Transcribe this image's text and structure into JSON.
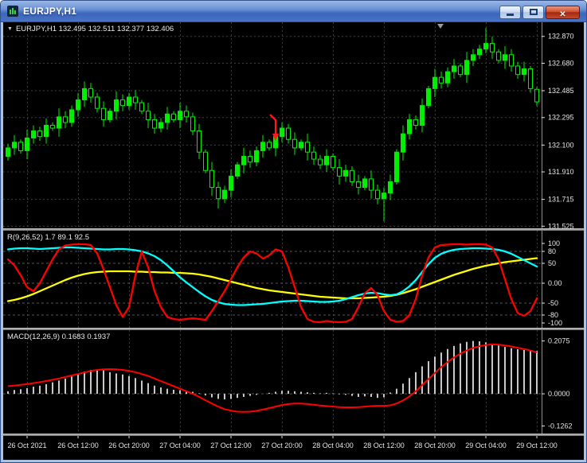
{
  "window": {
    "title": "EURJPY,H1",
    "close_glyph": "✕"
  },
  "icons": {
    "dropdown_glyph": "▼"
  },
  "colors": {
    "background": "#000000",
    "grid": "#3e3e3e",
    "level": "#565656",
    "axis_line": "#8c8c8c",
    "axis_text": "#e6e6e6",
    "candle": "#00ef00",
    "bear_fill": "#000000",
    "macd_hist": "#c8c8c8",
    "macd_signal": "#ff0000"
  },
  "time_axis": {
    "labels": [
      "26 Oct 2021",
      "26 Oct 12:00",
      "26 Oct 20:00",
      "27 Oct 04:00",
      "27 Oct 12:00",
      "27 Oct 20:00",
      "28 Oct 04:00",
      "28 Oct 12:00",
      "28 Oct 20:00",
      "29 Oct 04:00",
      "29 Oct 12:00"
    ]
  },
  "chart_data": [
    {
      "type": "candlestick",
      "title": "EURJPY,H1 132.495 132.511 132.377 132.406",
      "ohlc": {
        "open": "132.495",
        "high": "132.511",
        "low": "132.377",
        "close": "132.406"
      },
      "ylim": [
        131.51,
        132.97
      ],
      "grid_h": true,
      "y_ticks": [
        {
          "v": 132.87,
          "label": "132.870"
        },
        {
          "v": 132.68,
          "label": "132.680"
        },
        {
          "v": 132.485,
          "label": "132.485"
        },
        {
          "v": 132.295,
          "label": "132.295"
        },
        {
          "v": 132.1,
          "label": "132.100"
        },
        {
          "v": 131.91,
          "label": "131.910"
        },
        {
          "v": 131.715,
          "label": "131.715"
        },
        {
          "v": 131.525,
          "label": "131.525"
        }
      ],
      "annotations": [
        {
          "type": "sell-arrow",
          "index": 42,
          "price": 132.13,
          "color": "#ff1a1a"
        }
      ],
      "candles": [
        [
          132.02,
          132.11,
          131.99,
          132.08
        ],
        [
          132.08,
          132.17,
          132.03,
          132.12
        ],
        [
          132.12,
          132.14,
          132.04,
          132.06
        ],
        [
          132.06,
          132.21,
          132.0,
          132.15
        ],
        [
          132.15,
          132.24,
          132.11,
          132.2
        ],
        [
          132.2,
          132.23,
          132.13,
          132.16
        ],
        [
          132.16,
          132.29,
          132.11,
          132.24
        ],
        [
          132.24,
          132.26,
          132.2,
          132.22
        ],
        [
          132.22,
          132.36,
          132.16,
          132.3
        ],
        [
          132.3,
          132.34,
          132.22,
          132.26
        ],
        [
          132.26,
          132.38,
          132.23,
          132.35
        ],
        [
          132.35,
          132.47,
          132.3,
          132.42
        ],
        [
          132.42,
          132.55,
          132.37,
          132.5
        ],
        [
          132.5,
          132.54,
          132.4,
          132.44
        ],
        [
          132.44,
          132.47,
          132.33,
          132.36
        ],
        [
          132.36,
          132.41,
          132.23,
          132.28
        ],
        [
          132.28,
          132.36,
          132.26,
          132.34
        ],
        [
          132.34,
          132.48,
          132.28,
          132.42
        ],
        [
          132.42,
          132.46,
          132.34,
          132.38
        ],
        [
          132.38,
          132.47,
          132.35,
          132.44
        ],
        [
          132.44,
          132.49,
          132.35,
          132.4
        ],
        [
          132.4,
          132.42,
          132.32,
          132.34
        ],
        [
          132.34,
          132.4,
          132.22,
          132.28
        ],
        [
          132.28,
          132.32,
          132.18,
          132.22
        ],
        [
          132.22,
          132.29,
          132.19,
          132.26
        ],
        [
          132.26,
          132.37,
          132.21,
          132.32
        ],
        [
          132.32,
          132.34,
          132.26,
          132.28
        ],
        [
          132.28,
          132.4,
          132.22,
          132.34
        ],
        [
          132.34,
          132.38,
          132.26,
          132.3
        ],
        [
          132.3,
          132.33,
          132.17,
          132.2
        ],
        [
          132.2,
          132.25,
          132.0,
          132.05
        ],
        [
          132.05,
          132.07,
          131.9,
          131.92
        ],
        [
          131.92,
          131.98,
          131.74,
          131.8
        ],
        [
          131.8,
          131.84,
          131.65,
          131.72
        ],
        [
          131.72,
          131.81,
          131.69,
          131.78
        ],
        [
          131.78,
          131.93,
          131.73,
          131.88
        ],
        [
          131.88,
          131.98,
          131.86,
          131.96
        ],
        [
          131.96,
          132.08,
          131.9,
          132.02
        ],
        [
          132.02,
          132.06,
          131.94,
          131.98
        ],
        [
          131.98,
          132.09,
          131.95,
          132.06
        ],
        [
          132.06,
          132.17,
          132.01,
          132.12
        ],
        [
          132.12,
          132.14,
          132.06,
          132.08
        ],
        [
          132.08,
          132.22,
          132.02,
          132.16
        ],
        [
          132.16,
          132.26,
          132.12,
          132.22
        ],
        [
          132.22,
          132.25,
          132.11,
          132.14
        ],
        [
          132.14,
          132.19,
          132.03,
          132.08
        ],
        [
          132.08,
          132.14,
          132.06,
          132.12
        ],
        [
          132.12,
          132.18,
          131.99,
          132.05
        ],
        [
          132.05,
          132.09,
          131.96,
          132.0
        ],
        [
          132.0,
          132.03,
          131.93,
          131.96
        ],
        [
          131.96,
          132.07,
          131.91,
          132.02
        ],
        [
          132.02,
          132.04,
          131.92,
          131.94
        ],
        [
          131.94,
          132.0,
          131.82,
          131.88
        ],
        [
          131.88,
          131.96,
          131.84,
          131.92
        ],
        [
          131.92,
          131.95,
          131.81,
          131.84
        ],
        [
          131.84,
          131.89,
          131.75,
          131.8
        ],
        [
          131.8,
          131.88,
          131.78,
          131.86
        ],
        [
          131.86,
          131.92,
          131.72,
          131.78
        ],
        [
          131.78,
          131.82,
          131.68,
          131.72
        ],
        [
          131.72,
          131.8,
          131.56,
          131.76
        ],
        [
          131.76,
          131.89,
          131.71,
          131.84
        ],
        [
          131.84,
          132.07,
          131.82,
          132.05
        ],
        [
          132.05,
          132.24,
          131.99,
          132.18
        ],
        [
          132.18,
          132.32,
          132.14,
          132.28
        ],
        [
          132.28,
          132.31,
          132.21,
          132.24
        ],
        [
          132.24,
          132.43,
          132.19,
          132.38
        ],
        [
          132.38,
          132.52,
          132.36,
          132.5
        ],
        [
          132.5,
          132.64,
          132.44,
          132.58
        ],
        [
          132.58,
          132.62,
          132.5,
          132.54
        ],
        [
          132.54,
          132.65,
          132.51,
          132.62
        ],
        [
          132.62,
          132.71,
          132.57,
          132.66
        ],
        [
          132.66,
          132.68,
          132.58,
          132.6
        ],
        [
          132.6,
          132.76,
          132.54,
          132.7
        ],
        [
          132.7,
          132.78,
          132.66,
          132.74
        ],
        [
          132.74,
          132.81,
          132.71,
          132.78
        ],
        [
          132.78,
          132.93,
          132.75,
          132.82
        ],
        [
          132.82,
          132.87,
          132.71,
          132.76
        ],
        [
          132.76,
          132.78,
          132.68,
          132.7
        ],
        [
          132.7,
          132.8,
          132.64,
          132.74
        ],
        [
          132.74,
          132.78,
          132.62,
          132.66
        ],
        [
          132.66,
          132.69,
          132.57,
          132.6
        ],
        [
          132.6,
          132.69,
          132.55,
          132.64
        ],
        [
          132.64,
          132.66,
          132.47,
          132.5
        ],
        [
          132.495,
          132.511,
          132.377,
          132.406
        ]
      ]
    },
    {
      "type": "line",
      "title": "R(9,26,52) 1.7 89.1 92.5",
      "ylim": [
        -112,
        132
      ],
      "levels": [
        80,
        50,
        0,
        -50,
        -80
      ],
      "y_ticks": [
        {
          "v": 100,
          "label": "100"
        },
        {
          "v": 80,
          "label": "80"
        },
        {
          "v": 50,
          "label": "50"
        },
        {
          "v": 0,
          "label": "0.00"
        },
        {
          "v": -50,
          "label": "-50"
        },
        {
          "v": -80,
          "label": "-80"
        },
        {
          "v": -100,
          "label": "-100"
        }
      ],
      "series": [
        {
          "name": "slow",
          "color": "#ffff00",
          "values": [
            -45,
            -42,
            -38,
            -33,
            -27,
            -20,
            -13,
            -6,
            1,
            8,
            14,
            19,
            23,
            26,
            28,
            29,
            30,
            30,
            30,
            30,
            29,
            29,
            28,
            28,
            27,
            27,
            26,
            26,
            25,
            24,
            22,
            19,
            16,
            12,
            8,
            4,
            0,
            -4,
            -8,
            -12,
            -15,
            -18,
            -20,
            -22,
            -24,
            -26,
            -28,
            -30,
            -32,
            -34,
            -35,
            -36,
            -37,
            -38,
            -38,
            -38,
            -37,
            -36,
            -35,
            -34,
            -32,
            -29,
            -25,
            -20,
            -15,
            -9,
            -3,
            3,
            9,
            15,
            21,
            26,
            31,
            36,
            40,
            44,
            47,
            50,
            53,
            55,
            57,
            59,
            61,
            63
          ]
        },
        {
          "name": "medium",
          "color": "#00ffff",
          "values": [
            85,
            87,
            88,
            88,
            87,
            86,
            87,
            88,
            89,
            90,
            90,
            89,
            88,
            87,
            86,
            85,
            85,
            86,
            86,
            85,
            83,
            80,
            75,
            68,
            58,
            45,
            30,
            15,
            2,
            -10,
            -22,
            -33,
            -42,
            -48,
            -52,
            -54,
            -55,
            -55,
            -54,
            -53,
            -52,
            -50,
            -48,
            -46,
            -45,
            -44,
            -44,
            -45,
            -46,
            -47,
            -47,
            -46,
            -44,
            -40,
            -35,
            -30,
            -26,
            -24,
            -25,
            -28,
            -30,
            -28,
            -20,
            -8,
            8,
            28,
            48,
            64,
            74,
            80,
            84,
            86,
            87,
            88,
            88,
            87,
            86,
            84,
            80,
            74,
            66,
            58,
            50,
            42
          ]
        },
        {
          "name": "fast",
          "color": "#ff0000",
          "values": [
            60,
            45,
            20,
            -10,
            -20,
            0,
            30,
            60,
            85,
            95,
            97,
            98,
            98,
            96,
            75,
            35,
            -10,
            -55,
            -85,
            -60,
            20,
            80,
            40,
            -20,
            -60,
            -85,
            -90,
            -92,
            -90,
            -88,
            -90,
            -92,
            -70,
            -45,
            -20,
            10,
            40,
            65,
            80,
            75,
            62,
            70,
            85,
            80,
            40,
            -10,
            -60,
            -90,
            -97,
            -98,
            -95,
            -97,
            -98,
            -97,
            -90,
            -60,
            -25,
            -12,
            -30,
            -70,
            -92,
            -97,
            -95,
            -80,
            -40,
            20,
            65,
            90,
            96,
            97,
            98,
            98,
            97,
            98,
            98,
            97,
            90,
            60,
            10,
            -40,
            -75,
            -82,
            -70,
            -38
          ]
        }
      ]
    },
    {
      "type": "macd",
      "title": "MACD(12,26,9) 0.1683 0.1937",
      "values": {
        "main": "0.1683",
        "signal": "0.1937"
      },
      "ylim": [
        -0.156,
        0.25
      ],
      "levels": [
        0
      ],
      "y_ticks": [
        {
          "v": 0.2075,
          "label": "0.2075"
        },
        {
          "v": 0,
          "label": "0.0000"
        },
        {
          "v": -0.1262,
          "label": "-0.1262"
        }
      ],
      "histogram": [
        0.01,
        0.015,
        0.018,
        0.022,
        0.028,
        0.032,
        0.038,
        0.045,
        0.052,
        0.06,
        0.068,
        0.078,
        0.088,
        0.094,
        0.096,
        0.092,
        0.085,
        0.08,
        0.076,
        0.07,
        0.062,
        0.052,
        0.042,
        0.032,
        0.025,
        0.02,
        0.016,
        0.014,
        0.012,
        0.008,
        0.002,
        -0.006,
        -0.014,
        -0.02,
        -0.022,
        -0.02,
        -0.016,
        -0.012,
        -0.008,
        -0.004,
        0.0,
        0.004,
        0.008,
        0.012,
        0.012,
        0.01,
        0.008,
        0.006,
        0.004,
        0.002,
        0.004,
        0.002,
        -0.002,
        -0.004,
        -0.008,
        -0.012,
        -0.01,
        -0.012,
        -0.016,
        -0.014,
        0.005,
        0.02,
        0.04,
        0.062,
        0.085,
        0.108,
        0.128,
        0.146,
        0.162,
        0.176,
        0.188,
        0.198,
        0.204,
        0.2075,
        0.206,
        0.202,
        0.196,
        0.19,
        0.184,
        0.179,
        0.175,
        0.172,
        0.17,
        0.1683
      ],
      "signal": [
        0.03,
        0.032,
        0.035,
        0.038,
        0.042,
        0.046,
        0.05,
        0.055,
        0.06,
        0.066,
        0.072,
        0.078,
        0.084,
        0.09,
        0.094,
        0.096,
        0.097,
        0.096,
        0.094,
        0.09,
        0.085,
        0.078,
        0.07,
        0.06,
        0.05,
        0.04,
        0.03,
        0.02,
        0.01,
        0.0,
        -0.012,
        -0.025,
        -0.038,
        -0.05,
        -0.06,
        -0.066,
        -0.07,
        -0.071,
        -0.07,
        -0.067,
        -0.062,
        -0.056,
        -0.05,
        -0.044,
        -0.04,
        -0.038,
        -0.038,
        -0.04,
        -0.043,
        -0.046,
        -0.048,
        -0.05,
        -0.052,
        -0.053,
        -0.053,
        -0.052,
        -0.05,
        -0.048,
        -0.047,
        -0.047,
        -0.045,
        -0.038,
        -0.026,
        -0.01,
        0.01,
        0.034,
        0.058,
        0.082,
        0.105,
        0.125,
        0.143,
        0.158,
        0.17,
        0.18,
        0.187,
        0.192,
        0.194,
        0.193,
        0.19,
        0.186,
        0.181,
        0.176,
        0.17,
        0.163
      ]
    }
  ]
}
